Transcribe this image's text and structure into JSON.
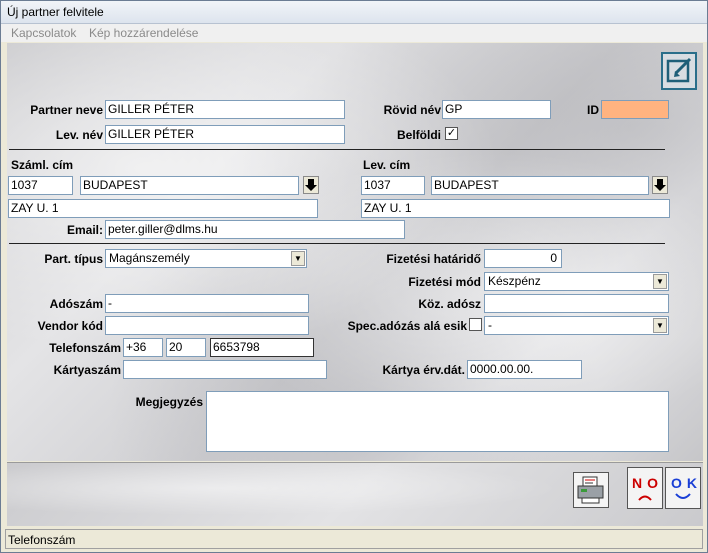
{
  "window": {
    "title": "Új partner felvitele"
  },
  "menu": [
    {
      "label": "Kapcsolatok"
    },
    {
      "label": "Kép hozzárendelése"
    }
  ],
  "form": {
    "partner_neve": {
      "label": "Partner neve",
      "value": "GILLER PÉTER"
    },
    "rovid_nev": {
      "label": "Rövid név",
      "value": "GP"
    },
    "id": {
      "label": "ID",
      "value": ""
    },
    "lev_nev": {
      "label": "Lev. név",
      "value": "GILLER PÉTER"
    },
    "belfoldi": {
      "label": "Belföldi",
      "checked": true,
      "mark": "✓"
    },
    "szaml_cim": {
      "label": "Száml. cím",
      "zip": "1037",
      "city": "BUDAPEST",
      "street": "ZAY U. 1"
    },
    "lev_cim": {
      "label": "Lev. cím",
      "zip": "1037",
      "city": "BUDAPEST",
      "street": "ZAY U. 1"
    },
    "email": {
      "label": "Email:",
      "value": "peter.giller@dlms.hu"
    },
    "part_tipus": {
      "label": "Part. típus",
      "value": "Magánszemély"
    },
    "fizetesi_hatarido": {
      "label": "Fizetési határidő",
      "value": "0"
    },
    "fizetesi_mod": {
      "label": "Fizetési mód",
      "value": "Készpénz"
    },
    "adoszam": {
      "label": "Adószám",
      "value": "-"
    },
    "koz_adosz": {
      "label": "Köz. adósz",
      "value": ""
    },
    "vendor_kod": {
      "label": "Vendor kód",
      "value": ""
    },
    "spec_adozas": {
      "label": "Spec.adózás alá esik",
      "checked": false,
      "value": "-"
    },
    "telefonszam": {
      "label": "Telefonszám",
      "country": "+36",
      "area": "20",
      "number": "6653798"
    },
    "kartyaszam": {
      "label": "Kártyaszám",
      "value": ""
    },
    "kartya_erv": {
      "label": "Kártya érv.dát.",
      "value": "0000.00.00."
    },
    "megjegyzes": {
      "label": "Megjegyzés",
      "value": ""
    }
  },
  "buttons": {
    "no": {
      "label": "NO"
    },
    "ok": {
      "label": "OK"
    }
  },
  "status": {
    "text": "Telefonszám"
  },
  "colors": {
    "id_field": "#ffb380",
    "no_text": "#cc0000",
    "ok_text": "#1a3fd6",
    "accent": "#2a6e8a"
  }
}
